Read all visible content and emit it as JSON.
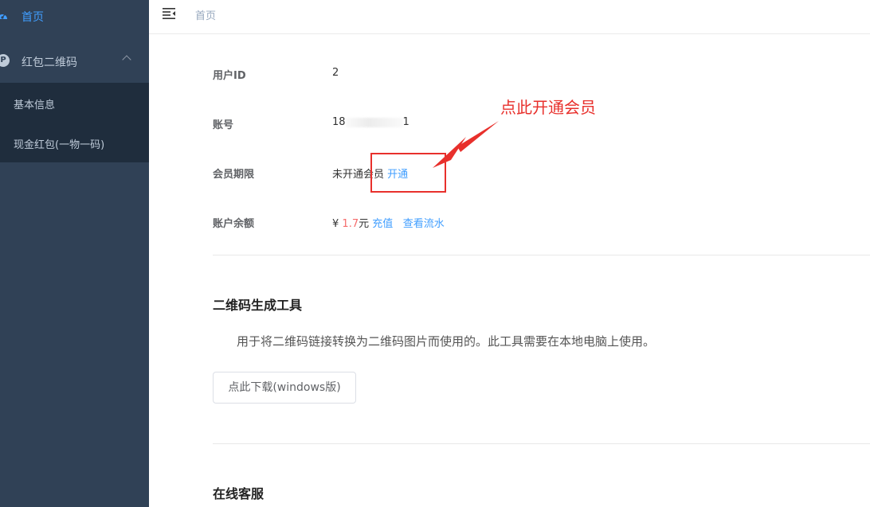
{
  "sidebar": {
    "home_label": "首页",
    "group_label": "红包二维码",
    "group_icon_letter": "P",
    "sub_items": [
      {
        "label": "基本信息"
      },
      {
        "label": "现金红包(一物一码)"
      }
    ]
  },
  "topbar": {
    "breadcrumb": "首页"
  },
  "info": {
    "user_id_label": "用户ID",
    "user_id_value": "2",
    "account_label": "账号",
    "account_prefix": "18",
    "account_suffix": "1",
    "membership_label": "会员期限",
    "membership_value": "未开通会员",
    "membership_link": "开通",
    "balance_label": "账户余额",
    "balance_currency": "¥",
    "balance_amount": "1.7",
    "balance_unit": "元",
    "recharge_link": "充值",
    "history_link": "查看流水"
  },
  "qr_tool": {
    "title": "二维码生成工具",
    "description": "用于将二维码链接转换为二维码图片而使用的。此工具需要在本地电脑上使用。",
    "download_button": "点此下载(windows版)"
  },
  "support": {
    "title": "在线客服"
  },
  "annotation": {
    "text": "点此开通会员",
    "color": "#e8302c"
  },
  "colors": {
    "sidebar_bg": "#304156",
    "submenu_bg": "#1f2d3d",
    "accent": "#409eff",
    "amount_red": "#f56c6c"
  }
}
